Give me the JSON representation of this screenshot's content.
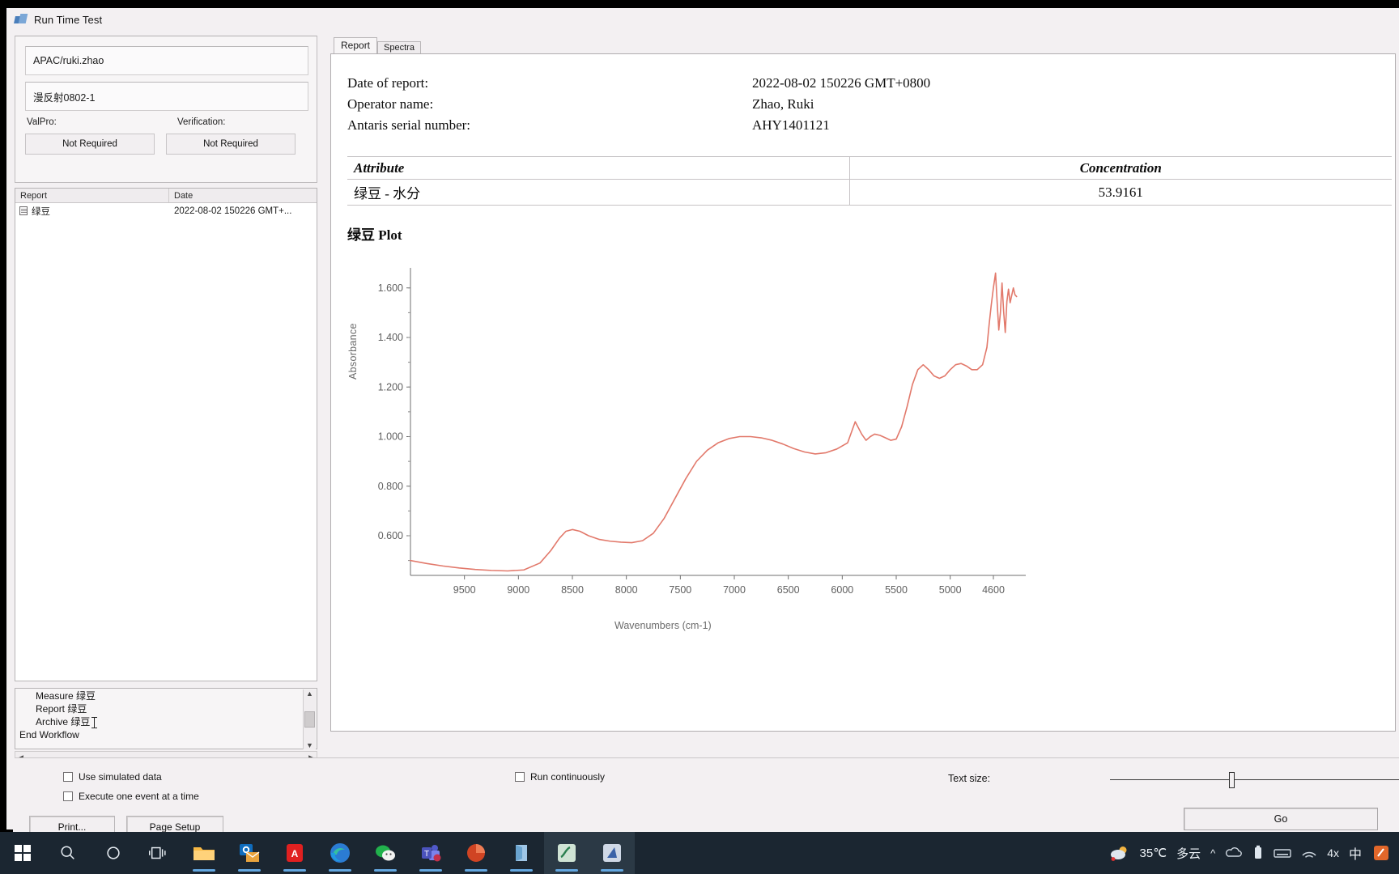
{
  "window": {
    "title": "Run Time Test",
    "icon": "app-icon"
  },
  "left_panel": {
    "user_field": "APAC/ruki.zhao",
    "sample_field": "漫反射0802-1",
    "valpro_label": "ValPro:",
    "verification_label": "Verification:",
    "valpro_status": "Not Required",
    "verification_status": "Not Required",
    "report_list": {
      "columns": [
        "Report",
        "Date"
      ],
      "rows": [
        {
          "report": "绿豆",
          "date": "2022-08-02 150226 GMT+..."
        }
      ]
    },
    "workflow_steps": [
      {
        "label": "Measure 绿豆",
        "selected": false,
        "indent": true
      },
      {
        "label": "Report 绿豆",
        "selected": false,
        "indent": true
      },
      {
        "label": "Archive 绿豆",
        "selected": true,
        "indent": true
      },
      {
        "label": "End Workflow",
        "selected": false,
        "indent": false
      }
    ]
  },
  "tabs": [
    {
      "label": "Report",
      "active": true
    },
    {
      "label": "Spectra",
      "active": false
    }
  ],
  "report": {
    "fields": [
      {
        "key": "Date of report:",
        "value": "2022-08-02 150226 GMT+0800"
      },
      {
        "key": "Operator name:",
        "value": "Zhao, Ruki"
      },
      {
        "key": "Antaris serial number:",
        "value": "AHY1401121"
      }
    ],
    "table": {
      "headers": [
        "Attribute",
        "Concentration"
      ],
      "rows": [
        {
          "attribute": "绿豆  - 水分",
          "concentration": "53.9161"
        }
      ]
    },
    "plot_title": "绿豆  Plot"
  },
  "chart_data": {
    "type": "line",
    "title": "绿豆  Plot",
    "xlabel": "Wavenumbers (cm-1)",
    "ylabel": "Absorbance",
    "xlim": [
      10000,
      4300
    ],
    "ylim": [
      0.44,
      1.72
    ],
    "x_ticks": [
      9500,
      9000,
      8500,
      8000,
      7500,
      7000,
      6500,
      6000,
      5500,
      5000,
      4600
    ],
    "y_ticks": [
      "0.600",
      "0.800",
      "1.000",
      "1.200",
      "1.400",
      "1.600"
    ],
    "grid": false,
    "legend": "none",
    "series": [
      {
        "name": "绿豆",
        "color": "#e2796b",
        "x": [
          10000,
          9850,
          9700,
          9550,
          9400,
          9250,
          9100,
          8950,
          8800,
          8700,
          8620,
          8560,
          8500,
          8430,
          8350,
          8250,
          8150,
          8050,
          7950,
          7850,
          7750,
          7650,
          7550,
          7450,
          7350,
          7250,
          7150,
          7050,
          6950,
          6850,
          6750,
          6650,
          6550,
          6450,
          6350,
          6250,
          6150,
          6050,
          5950,
          5880,
          5820,
          5780,
          5740,
          5700,
          5650,
          5600,
          5550,
          5500,
          5450,
          5400,
          5350,
          5300,
          5250,
          5200,
          5150,
          5100,
          5050,
          5000,
          4950,
          4900,
          4850,
          4800,
          4750,
          4700,
          4660,
          4640,
          4620,
          4600,
          4580,
          4565,
          4550,
          4535,
          4520,
          4505,
          4490,
          4475,
          4460,
          4445,
          4430,
          4415,
          4400,
          4385
        ],
        "y": [
          0.5,
          0.488,
          0.478,
          0.47,
          0.464,
          0.46,
          0.458,
          0.462,
          0.49,
          0.54,
          0.59,
          0.618,
          0.625,
          0.618,
          0.6,
          0.585,
          0.578,
          0.574,
          0.572,
          0.58,
          0.61,
          0.67,
          0.75,
          0.83,
          0.9,
          0.945,
          0.975,
          0.992,
          1.0,
          1.0,
          0.995,
          0.985,
          0.97,
          0.952,
          0.938,
          0.93,
          0.935,
          0.95,
          0.975,
          1.06,
          1.01,
          0.985,
          1.0,
          1.01,
          1.005,
          0.995,
          0.985,
          0.99,
          1.04,
          1.12,
          1.21,
          1.27,
          1.29,
          1.27,
          1.245,
          1.235,
          1.245,
          1.27,
          1.29,
          1.295,
          1.285,
          1.27,
          1.27,
          1.29,
          1.36,
          1.45,
          1.53,
          1.6,
          1.66,
          1.54,
          1.43,
          1.5,
          1.62,
          1.505,
          1.42,
          1.545,
          1.595,
          1.54,
          1.57,
          1.6,
          1.572,
          1.565
        ]
      }
    ]
  },
  "bottom": {
    "checkboxes": [
      {
        "label": "Use simulated data",
        "checked": false
      },
      {
        "label": "Execute one event at a time",
        "checked": false
      },
      {
        "label": "Run continuously",
        "checked": false
      }
    ],
    "print_button": "Print...",
    "page_setup_button": "Page Setup",
    "text_size_label": "Text size:",
    "go_button": "Go"
  },
  "taskbar": {
    "items": [
      {
        "name": "start-button",
        "icon": "windows-logo"
      },
      {
        "name": "search-button",
        "icon": "search-icon"
      },
      {
        "name": "cortana-button",
        "icon": "circle-icon"
      },
      {
        "name": "task-view-button",
        "icon": "task-view-icon"
      },
      {
        "name": "file-explorer",
        "icon": "folder-icon"
      },
      {
        "name": "outlook",
        "icon": "outlook-icon"
      },
      {
        "name": "adobe-reader",
        "icon": "adobe-icon"
      },
      {
        "name": "microsoft-edge",
        "icon": "edge-icon"
      },
      {
        "name": "wechat",
        "icon": "wechat-icon"
      },
      {
        "name": "microsoft-teams",
        "icon": "teams-icon"
      },
      {
        "name": "powerpoint",
        "icon": "powerpoint-icon"
      },
      {
        "name": "onenote",
        "icon": "onenote-icon"
      },
      {
        "name": "result-app",
        "icon": "result-icon"
      },
      {
        "name": "thermo-app",
        "icon": "thermo-icon"
      }
    ],
    "tray": {
      "temperature": "35℃",
      "weather": "多云",
      "ime": "中",
      "volume": "4x"
    }
  }
}
